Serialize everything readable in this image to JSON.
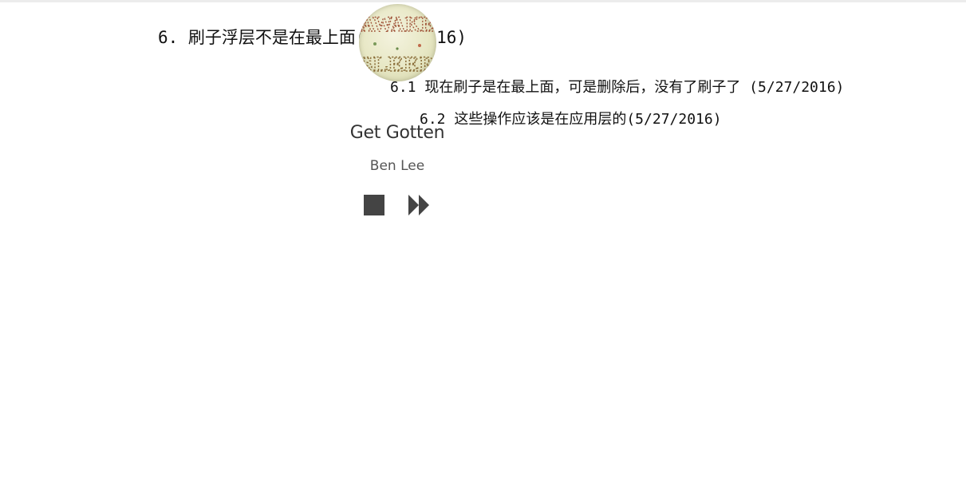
{
  "notes": {
    "main": "6.  刷子浮层不是在最上面(5/27/2016)",
    "sub_1": "6.1 现在刷子是在最上面，可是删除后，没有了刷子了  (5/27/2016)",
    "sub_2": "6.2 这些操作应该是在应用层的(5/27/2016)"
  },
  "player": {
    "album_art_text": "AWAKE SLEEP",
    "title": "Get Gotten",
    "artist": "Ben Lee",
    "controls": {
      "stop_icon": "stop-icon",
      "next_icon": "fast-forward-icon"
    }
  },
  "colors": {
    "text_dark": "#111111",
    "title": "#333333",
    "artist": "#555555",
    "controls": "#444444"
  }
}
